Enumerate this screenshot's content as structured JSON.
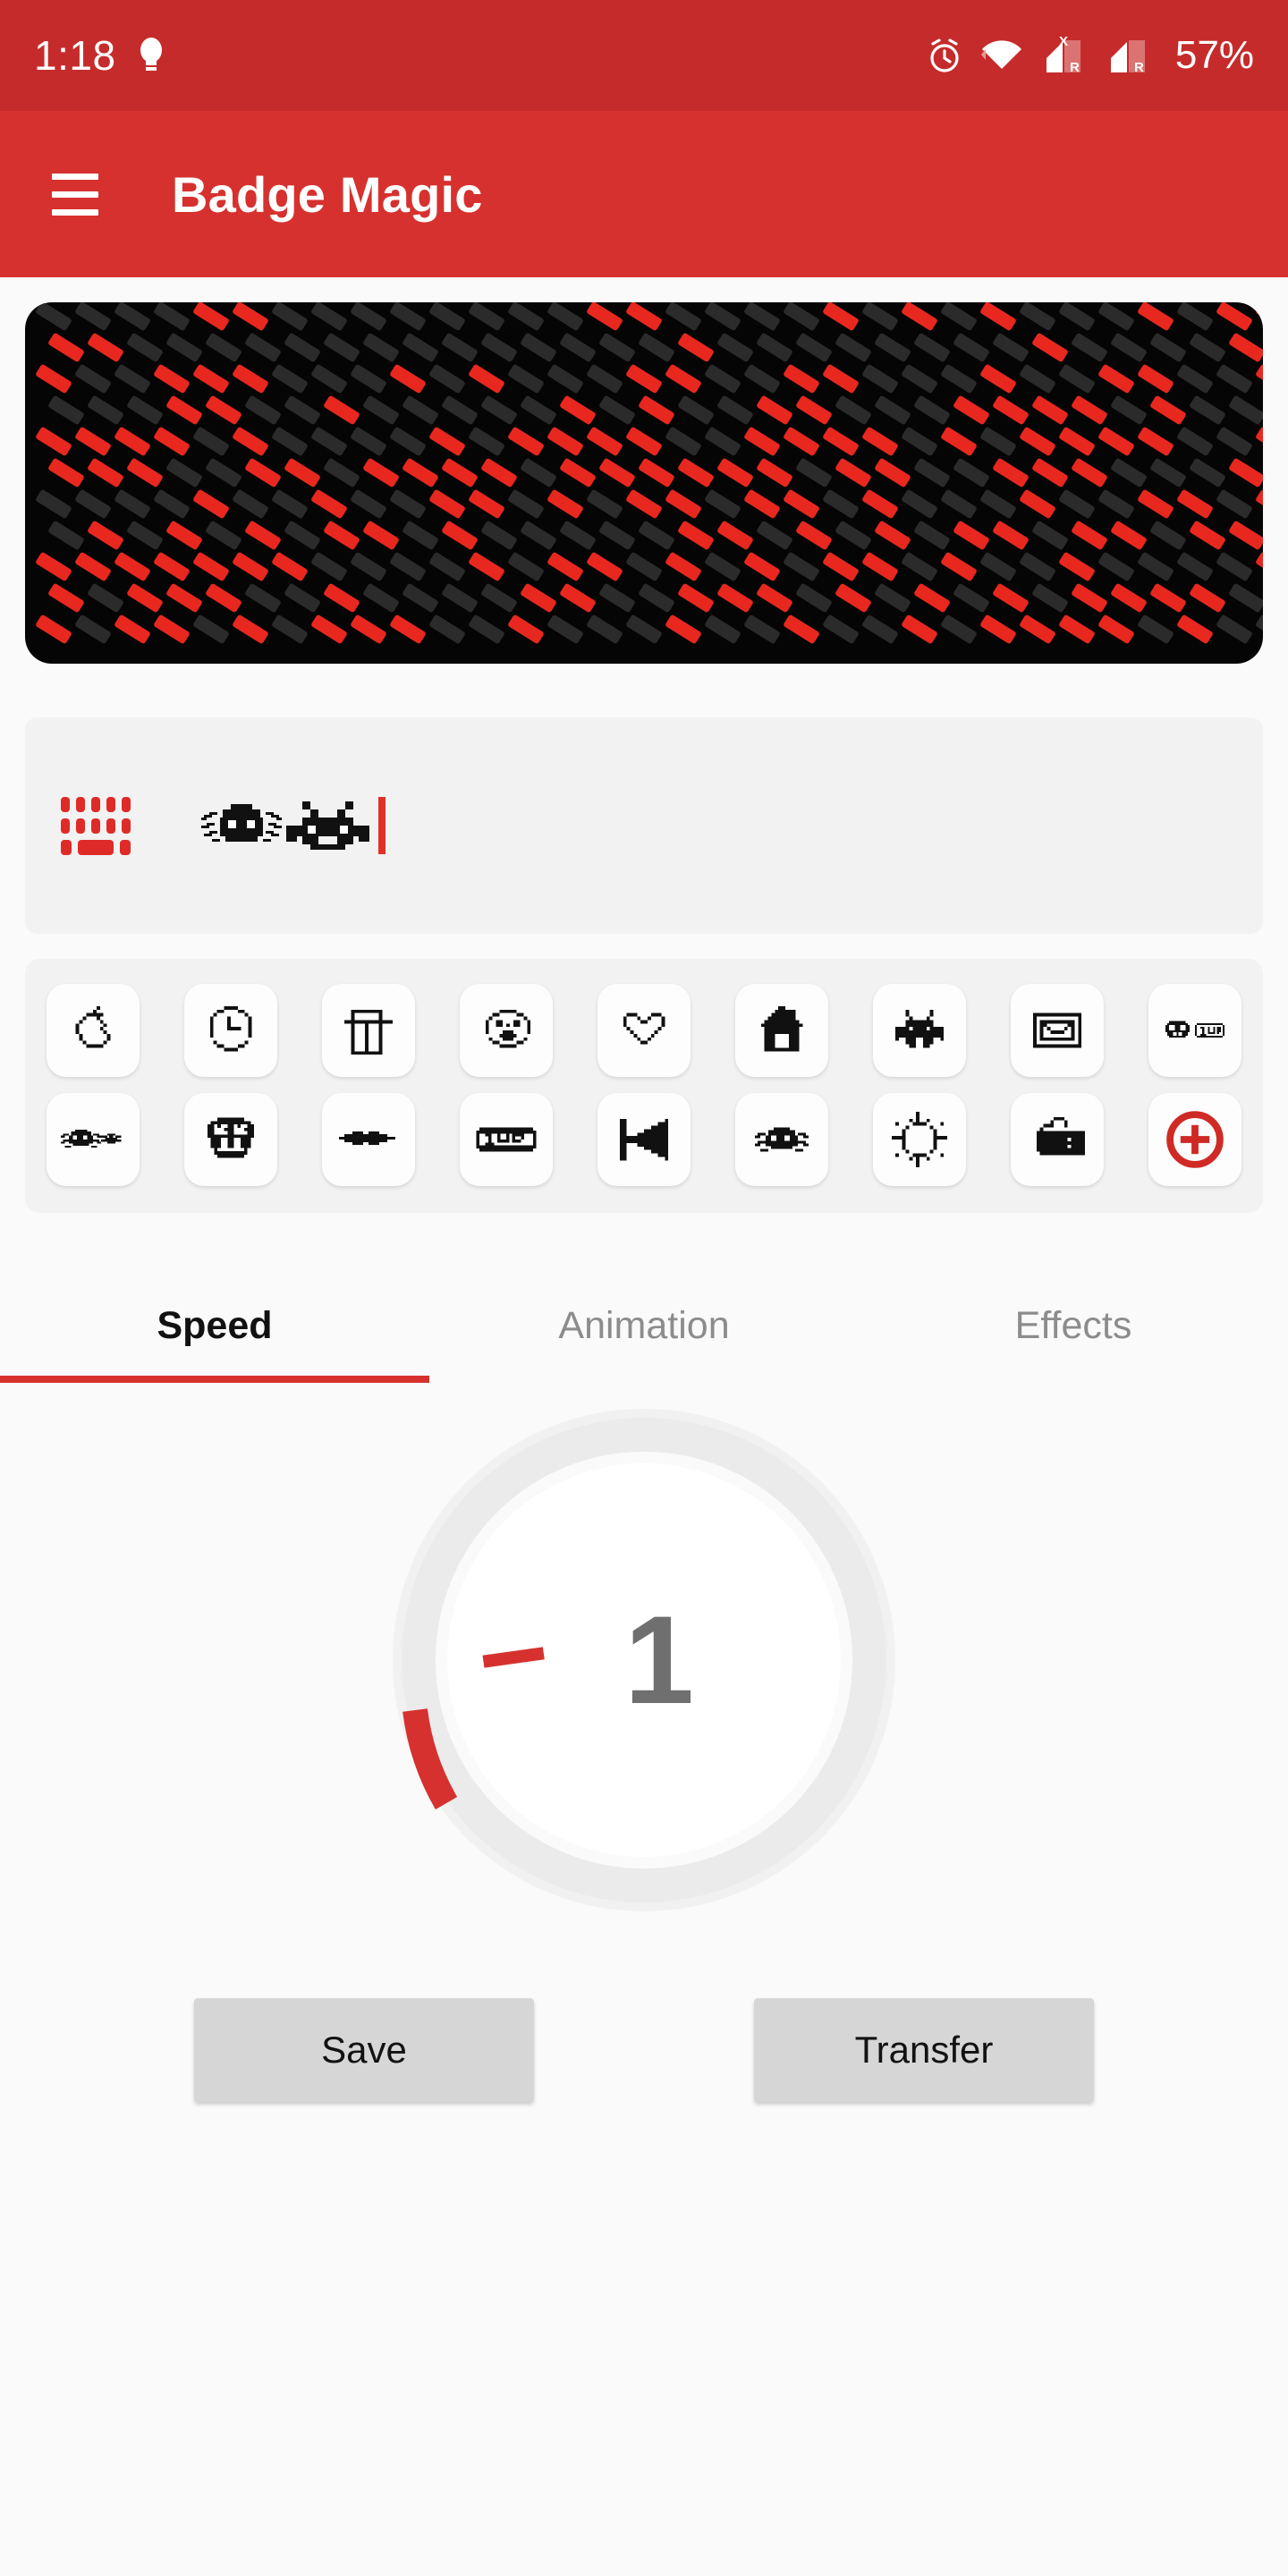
{
  "status_bar": {
    "time": "1:18",
    "battery": "57%",
    "icons": [
      "bulb-icon",
      "alarm-icon",
      "wifi-icon",
      "signal-1-icon",
      "signal-2-icon"
    ],
    "signal_1_badge_top": "X",
    "signal_1_badge_bottom": "R",
    "signal_2_badge_bottom": "R",
    "background": "#c62b2b"
  },
  "app_bar": {
    "title": "Badge Magic",
    "menu_icon": "hamburger-icon",
    "background": "#d6312e"
  },
  "badge_preview": {
    "label": "led-badge-preview",
    "columns": 32,
    "rows": 11,
    "on_color": "#e8281f",
    "off_color": "#2b2b2b",
    "background": "#050505"
  },
  "text_input": {
    "keyboard_icon": "keyboard-icon",
    "value_glyphs": [
      "spider-pixel-glyph",
      "space-invader-pixel-glyph"
    ],
    "caret": true,
    "placeholder": "",
    "background": "#f2f2f2"
  },
  "palette": {
    "rows": [
      [
        {
          "name": "apple-icon"
        },
        {
          "name": "clock-icon"
        },
        {
          "name": "trash-bin-icon"
        },
        {
          "name": "face-icon"
        },
        {
          "name": "heart-icon"
        },
        {
          "name": "house-icon"
        },
        {
          "name": "space-invader-icon"
        },
        {
          "name": "envelope-icon"
        },
        {
          "name": "mushroom-1up-icon"
        }
      ],
      [
        {
          "name": "spiders-icon"
        },
        {
          "name": "mushroom-icon"
        },
        {
          "name": "mustache-icon"
        },
        {
          "name": "one-up-icon"
        },
        {
          "name": "speaker-icon"
        },
        {
          "name": "spider-icon"
        },
        {
          "name": "sun-icon"
        },
        {
          "name": "pointing-hand-icon"
        },
        {
          "name": "add-icon"
        }
      ]
    ],
    "add_button_color": "#cf2a26",
    "background": "#f2f2f2"
  },
  "tabs": {
    "items": [
      {
        "label": "Speed",
        "active": true
      },
      {
        "label": "Animation",
        "active": false
      },
      {
        "label": "Effects",
        "active": false
      }
    ],
    "indicator_color": "#d6312e",
    "active_color": "#111111",
    "inactive_color": "#8c8c8c"
  },
  "speed_dial": {
    "name": "speed-dial",
    "value": "1",
    "min": 1,
    "max": 8,
    "arc_color": "#d6312e",
    "track_color": "#ebebeb",
    "value_color": "#6f6f6f"
  },
  "actions": {
    "save_label": "Save",
    "transfer_label": "Transfer",
    "button_color": "#d6d6d6"
  }
}
